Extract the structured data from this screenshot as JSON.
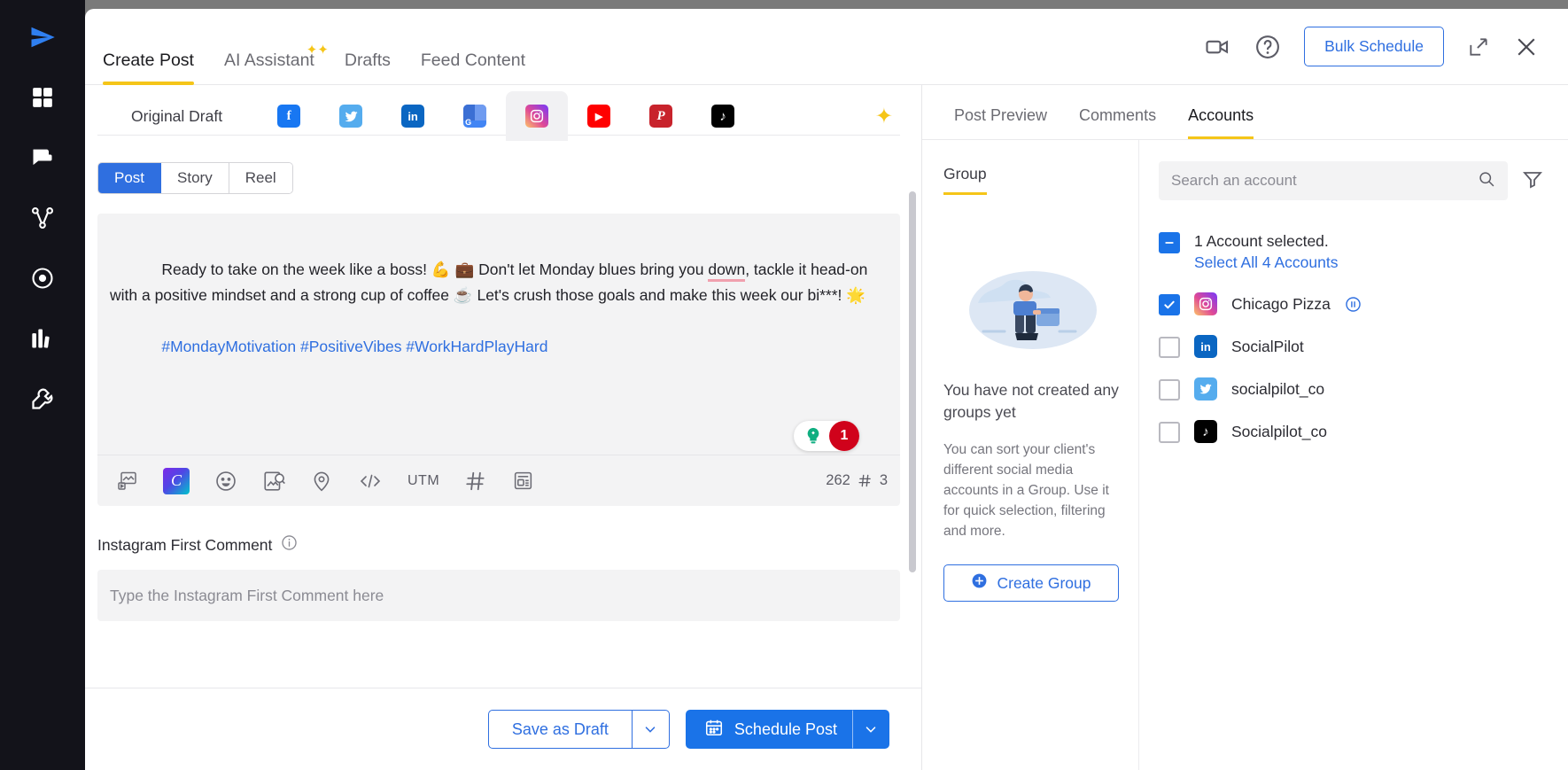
{
  "app": {
    "rail_items": [
      {
        "name": "send-icon",
        "label": "Send"
      },
      {
        "name": "dashboard-icon",
        "label": "Dashboard"
      },
      {
        "name": "inbox-icon",
        "label": "Inbox"
      },
      {
        "name": "network-icon",
        "label": "Network"
      },
      {
        "name": "target-icon",
        "label": "Discovery"
      },
      {
        "name": "analytics-icon",
        "label": "Analytics"
      },
      {
        "name": "tools-icon",
        "label": "Tools"
      }
    ]
  },
  "header": {
    "tabs": [
      {
        "label": "Create Post",
        "active": true,
        "sparkle": false
      },
      {
        "label": "AI Assistant",
        "active": false,
        "sparkle": true
      },
      {
        "label": "Drafts",
        "active": false,
        "sparkle": false
      },
      {
        "label": "Feed Content",
        "active": false,
        "sparkle": false
      }
    ],
    "video_icon": "video-camera-icon",
    "help_icon": "help-circle-icon",
    "bulk_schedule_label": "Bulk Schedule",
    "minimize_icon": "minimize-icon",
    "close_icon": "close-icon",
    "accent_blue": "#2f6fe0",
    "accent_yellow": "#f5c518"
  },
  "composer": {
    "original_draft_label": "Original Draft",
    "network_tabs": [
      {
        "name": "facebook",
        "glyph": "f",
        "color": "#1877f2",
        "active": false
      },
      {
        "name": "twitter",
        "glyph": "ᵗ",
        "color": "#55acee",
        "active": false
      },
      {
        "name": "linkedin",
        "glyph": "in",
        "color": "#0a66c2",
        "active": false
      },
      {
        "name": "google-business",
        "glyph": "G",
        "color": "#4285f4",
        "active": false
      },
      {
        "name": "instagram",
        "glyph": "◎",
        "color": "#e1306c",
        "active": true
      },
      {
        "name": "youtube",
        "glyph": "▶",
        "color": "#ff0000",
        "active": false
      },
      {
        "name": "pinterest",
        "glyph": "P",
        "color": "#c8232c",
        "active": false
      },
      {
        "name": "tiktok",
        "glyph": "♪",
        "color": "#010101",
        "active": false
      }
    ],
    "ai_sparkle_icon": "ai-sparkle-icon",
    "post_types": [
      {
        "label": "Post",
        "active": true
      },
      {
        "label": "Story",
        "active": false
      },
      {
        "label": "Reel",
        "active": false
      }
    ],
    "text": {
      "part1": "Ready to take on the week like a boss! 💪 💼 Don't let Monday blues bring you ",
      "error_word": "down",
      "part2": ", tackle it head-on with a positive mindset and a strong cup of coffee ☕ Let's crush those goals and make this week our bi***! 🌟",
      "hashtags": "#MondayMotivation #PositiveVibes #WorkHardPlayHard"
    },
    "grammarly": {
      "icon": "grammarly-bulb-icon",
      "count": "1",
      "bulb_color": "#0fae80",
      "count_color": "#d0021b"
    },
    "toolbar": [
      {
        "name": "media-library-icon",
        "label": ""
      },
      {
        "name": "canva-icon",
        "label": "C"
      },
      {
        "name": "emoji-icon",
        "label": ""
      },
      {
        "name": "image-search-icon",
        "label": ""
      },
      {
        "name": "location-icon",
        "label": ""
      },
      {
        "name": "code-snippet-icon",
        "label": ""
      },
      {
        "name": "utm-button",
        "label": "UTM"
      },
      {
        "name": "hashtag-icon",
        "label": ""
      },
      {
        "name": "content-template-icon",
        "label": ""
      }
    ],
    "char_count": "262",
    "hashtag_count": "3",
    "first_comment_label": "Instagram First Comment",
    "first_comment_info_icon": "info-icon",
    "first_comment_placeholder": "Type the Instagram First Comment here"
  },
  "actions": {
    "save_draft_label": "Save as Draft",
    "save_draft_caret": "chevron-down-icon",
    "schedule_label": "Schedule Post",
    "schedule_calendar_icon": "calendar-icon",
    "schedule_caret": "chevron-down-icon"
  },
  "right_panel": {
    "tabs": [
      {
        "label": "Post Preview",
        "active": false
      },
      {
        "label": "Comments",
        "active": false
      },
      {
        "label": "Accounts",
        "active": true
      }
    ],
    "group": {
      "tab_label": "Group",
      "illustration": "person-with-box-illustration",
      "empty_title": "You have not created any groups yet",
      "empty_desc": "You can sort your client's different social media accounts in a Group. Use it for quick selection, filtering and more.",
      "create_button_label": "Create Group",
      "create_button_icon": "plus-circle-icon"
    },
    "accounts": {
      "search_placeholder": "Search an account",
      "search_value": "",
      "search_icon": "search-icon",
      "filter_icon": "filter-icon",
      "selected_summary": "1 Account selected.",
      "select_all_label": "Select All 4 Accounts",
      "list": [
        {
          "name": "Chicago Pizza",
          "network": "instagram",
          "checked": true,
          "paused": true,
          "pause_icon": "pause-circle-icon"
        },
        {
          "name": "SocialPilot",
          "network": "linkedin",
          "checked": false,
          "paused": false
        },
        {
          "name": "socialpilot_co",
          "network": "twitter",
          "checked": false,
          "paused": false
        },
        {
          "name": "Socialpilot_co",
          "network": "tiktok",
          "checked": false,
          "paused": false
        }
      ]
    }
  }
}
